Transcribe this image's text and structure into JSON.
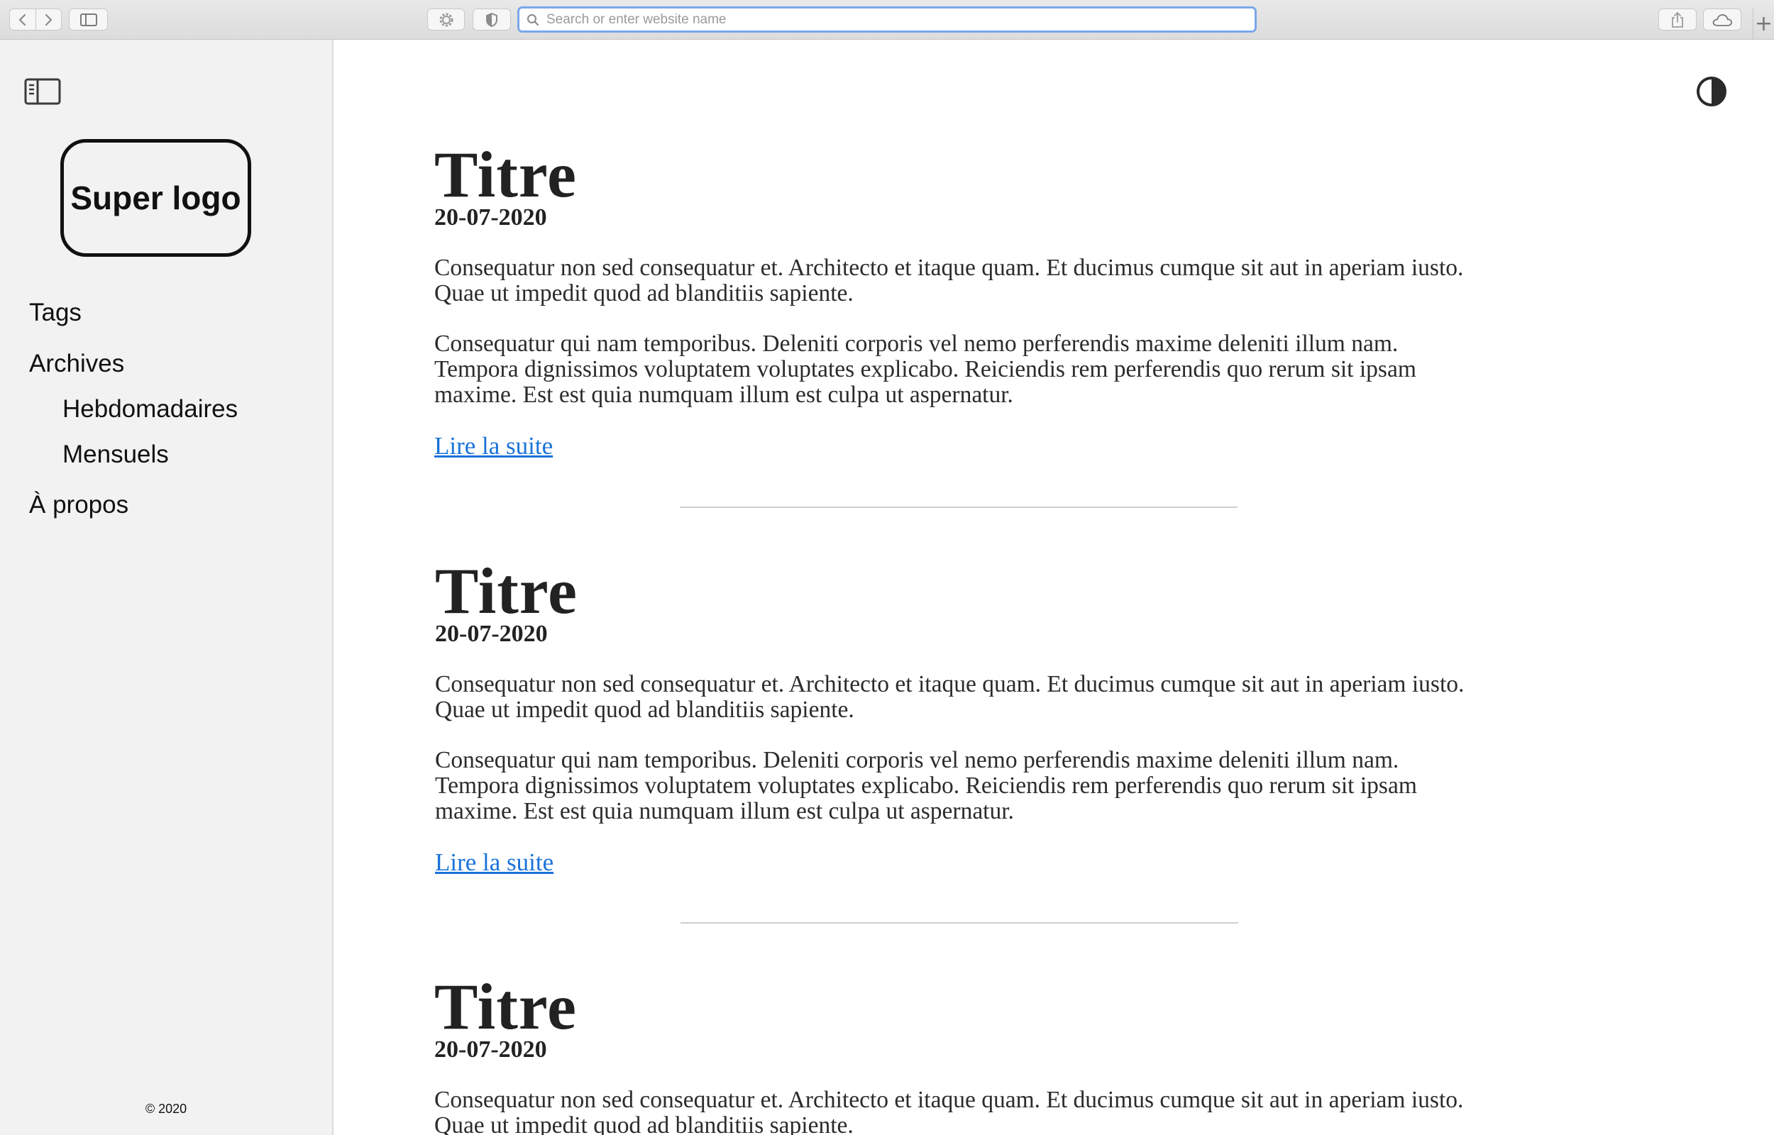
{
  "browser": {
    "address_placeholder": "Search or enter website name",
    "plus": "+"
  },
  "sidebar": {
    "logo_text": "Super logo",
    "nav": {
      "tags": "Tags",
      "archives": "Archives",
      "weekly": "Hebdomadaires",
      "monthly": "Mensuels",
      "about": "À propos"
    },
    "footer": "© 2020"
  },
  "articles": [
    {
      "title": "Titre",
      "date": "20-07-2020",
      "p1": "Consequatur non sed consequatur et. Architecto et itaque quam. Et ducimus cumque sit aut in aperiam iusto. Quae ut impedit quod ad blanditiis sapiente.",
      "p2": "Consequatur qui nam temporibus. Deleniti corporis vel nemo perferendis maxime deleniti illum nam. Tempora dignissimos voluptatem voluptates explicabo. Reiciendis rem perferendis quo rerum sit ipsam maxime. Est est quia numquam illum est culpa ut aspernatur.",
      "link": "Lire la suite"
    },
    {
      "title": "Titre",
      "date": "20-07-2020",
      "p1": "Consequatur non sed consequatur et. Architecto et itaque quam. Et ducimus cumque sit aut in aperiam iusto. Quae ut impedit quod ad blanditiis sapiente.",
      "p2": "Consequatur qui nam temporibus. Deleniti corporis vel nemo perferendis maxime deleniti illum nam. Tempora dignissimos voluptatem voluptates explicabo. Reiciendis rem perferendis quo rerum sit ipsam maxime. Est est quia numquam illum est culpa ut aspernatur.",
      "link": "Lire la suite"
    },
    {
      "title": "Titre",
      "date": "20-07-2020",
      "p1": "Consequatur non sed consequatur et. Architecto et itaque quam. Et ducimus cumque sit aut in aperiam iusto. Quae ut impedit quod ad blanditiis sapiente."
    }
  ],
  "colors": {
    "link": "#1a73d9",
    "sidebar_bg": "#f2f2f2",
    "address_focus": "#7aa7ea"
  },
  "icons": {
    "back": "chevron-left-icon",
    "forward": "chevron-right-icon",
    "sidebar": "sidebar-icon",
    "settings": "gear-icon",
    "shield": "shield-icon",
    "search": "search-icon",
    "share": "share-icon",
    "cloud": "cloud-icon",
    "theme": "contrast-icon"
  }
}
